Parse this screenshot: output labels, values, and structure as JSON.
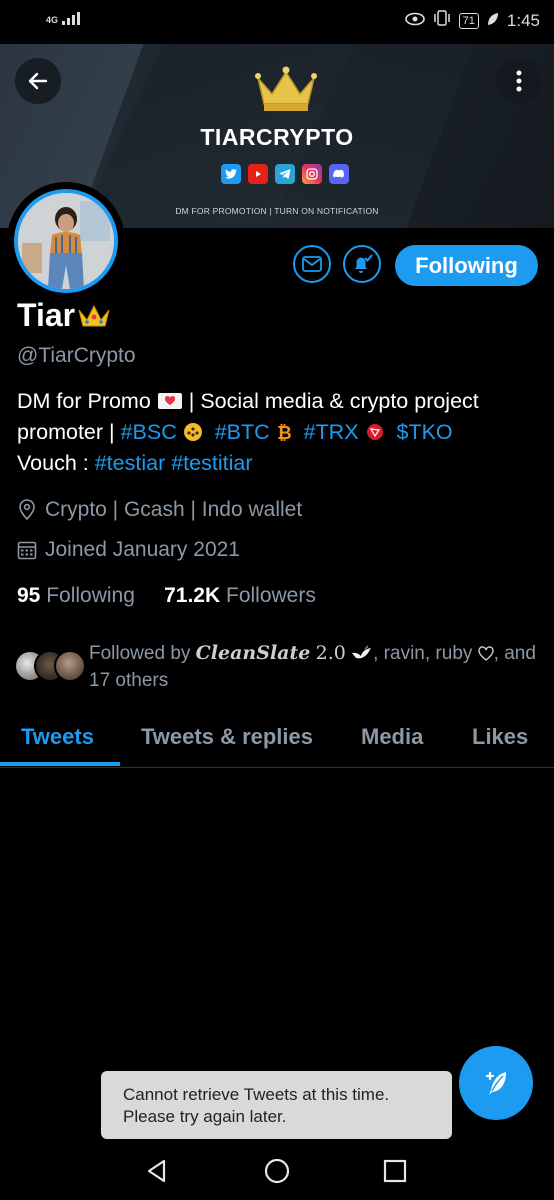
{
  "status_bar": {
    "network": "4G",
    "battery": "71",
    "time": "1:45"
  },
  "banner": {
    "brand": "TIARCRYPTO",
    "promo_text": "DM FOR PROMOTION | TURN ON NOTIFICATION",
    "socials": [
      "twitter-icon",
      "youtube-icon",
      "telegram-icon",
      "instagram-icon",
      "discord-icon"
    ]
  },
  "actions": {
    "follow_label": "Following"
  },
  "profile": {
    "name": "Tiar",
    "handle": "@TiarCrypto",
    "bio": {
      "line1_a": "DM for Promo",
      "line1_b": "| Social media & crypto project",
      "line2_a": "promoter |",
      "tag_bsc": "#BSC",
      "tag_btc": "#BTC",
      "tag_trx": "#TRX",
      "tag_tko": "$TKO",
      "line3_a": "Vouch :",
      "tag_testiar": "#testiar",
      "tag_testitiar": "#testitiar"
    },
    "location": "Crypto | Gcash | Indo wallet",
    "joined": "Joined January 2021",
    "following_count": "95",
    "following_label": "Following",
    "followers_count": "71.2K",
    "followers_label": "Followers",
    "followed_by": {
      "prefix": "Followed by",
      "name1": "CleanSlate",
      "name1_suffix": "2.0",
      "rest": ", ravin, ruby",
      "rest2": ", and",
      "others": "17 others"
    }
  },
  "tabs": [
    "Tweets",
    "Tweets & replies",
    "Media",
    "Likes"
  ],
  "toast": {
    "line1": "Cannot retrieve Tweets at this time.",
    "line2": "Please try again later."
  },
  "colors": {
    "accent": "#1d9bf0",
    "background": "#000000",
    "secondary_text": "#8b98a5"
  }
}
